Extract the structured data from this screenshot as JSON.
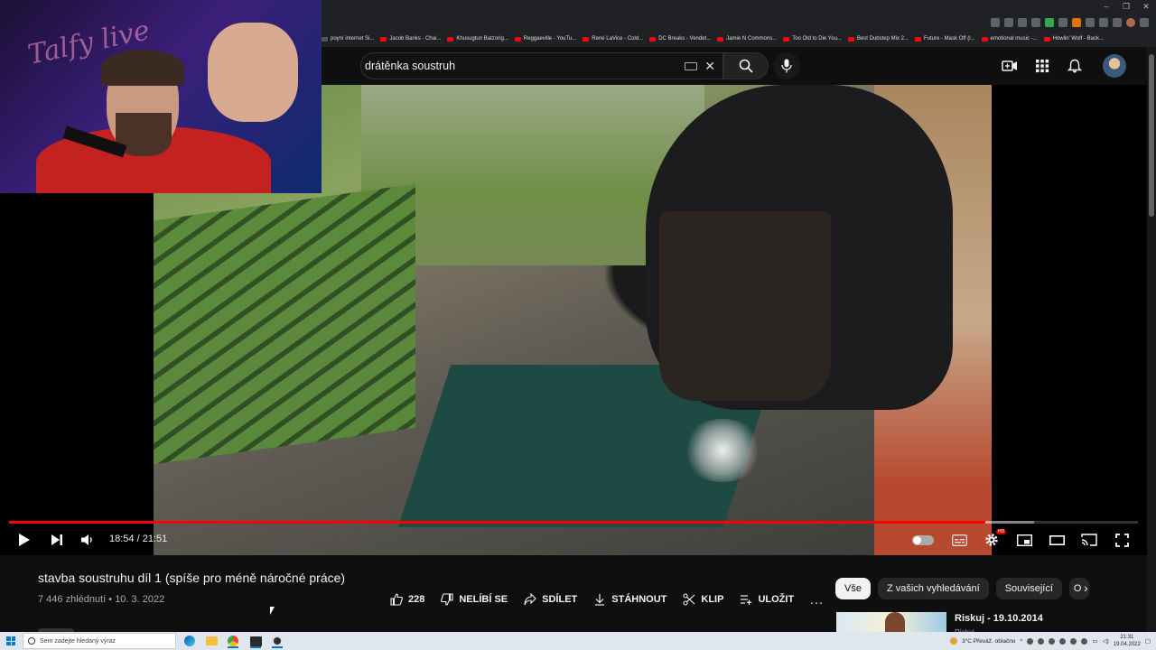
{
  "browser": {
    "bookmarks": [
      "poyní internet Si...",
      "Jacob Banks - Chai...",
      "Khusugtun Batzorig...",
      "Reggaeville - YouTu...",
      "René LaVice - Cold...",
      "DC Breaks - Vendet...",
      "Jamie N Commons...",
      "Too Old to Die You...",
      "Best Dubstep Mix 2...",
      "Future - Mask Off (l...",
      "emotional music -...",
      "Howlin' Wolf - Back..."
    ]
  },
  "header": {
    "search_value": "drátěnka soustruh"
  },
  "player": {
    "time": "18:54 / 21:51",
    "progress_fraction": 0.865,
    "buffer_fraction": 0.908,
    "quality_badge": "HD"
  },
  "video": {
    "title": "stavba soustruhu díl 1 (spíše pro méně náročné práce)",
    "meta": "7 446 zhlédnutí • 10. 3. 2022",
    "likes": "228",
    "dislike_label": "NELÍBÍ SE",
    "share_label": "SDÍLET",
    "download_label": "STÁHNOUT",
    "clip_label": "KLIP",
    "save_label": "ULOŽIT",
    "more_label": "..."
  },
  "chips": [
    "Vše",
    "Z vašich vyhledávání",
    "Související",
    "O"
  ],
  "recommendation": {
    "title": "Riskuj - 19.10.2014",
    "subtitle": "Riskuj"
  },
  "streamer_overlay": {
    "logo_text": "Talfy live"
  },
  "taskbar": {
    "search_placeholder": "Sem zadejte hledaný výraz",
    "weather": "3°C  Převáž. oblačno",
    "time": "21:31",
    "date": "19.04.2022"
  },
  "colors": {
    "accent_red": "#ff0000",
    "background": "#0f0f0f",
    "taskbar": "#dfe6ee"
  }
}
